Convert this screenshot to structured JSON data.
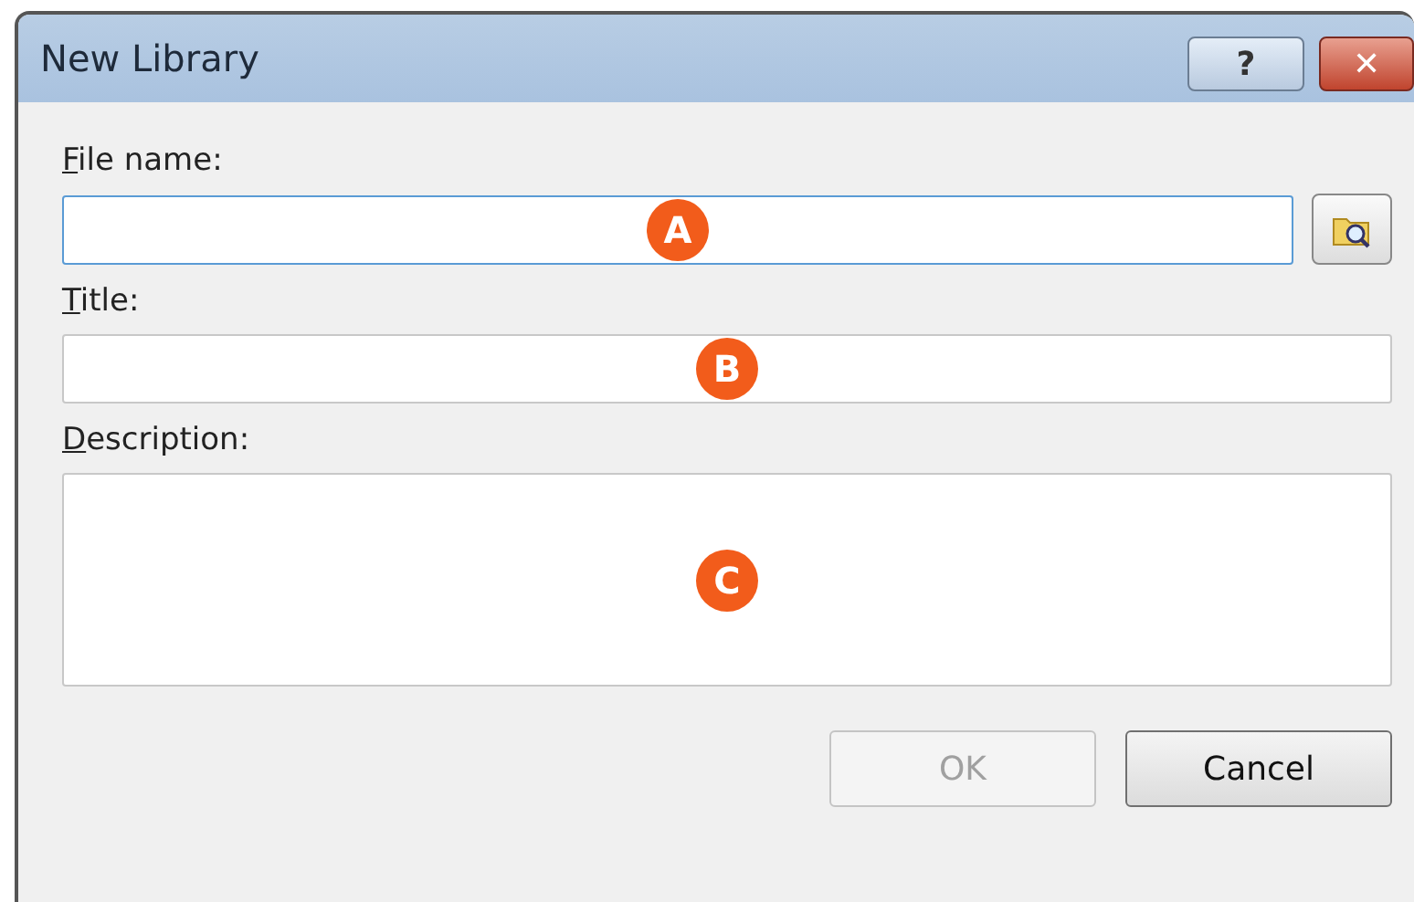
{
  "window": {
    "title": "New Library",
    "help_button": "?",
    "close_button": "✕"
  },
  "fields": [
    {
      "kind": "line",
      "label": "File name:",
      "access_key": true,
      "focused": true,
      "badge": "A",
      "browse": true
    },
    {
      "kind": "line",
      "label": "Title:",
      "access_key": true,
      "focused": false,
      "badge": "B",
      "browse": false
    },
    {
      "kind": "area",
      "label": "Description:",
      "access_key": true,
      "focused": false,
      "badge": "C",
      "browse": false
    }
  ],
  "buttons": [
    {
      "label": "OK",
      "disabled": true
    },
    {
      "label": "Cancel",
      "disabled": false
    }
  ]
}
